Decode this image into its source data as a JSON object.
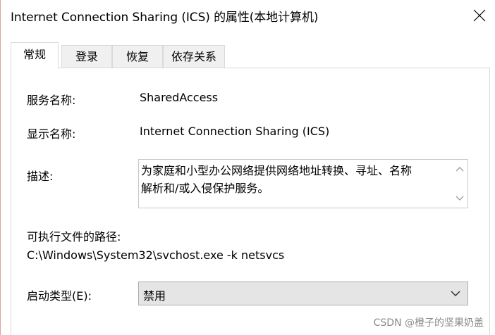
{
  "window": {
    "title": "Internet Connection Sharing (ICS) 的属性(本地计算机)"
  },
  "tabs": [
    {
      "label": "常规",
      "active": true
    },
    {
      "label": "登录",
      "active": false
    },
    {
      "label": "恢复",
      "active": false
    },
    {
      "label": "依存关系",
      "active": false
    }
  ],
  "general": {
    "service_name_label": "服务名称:",
    "service_name_value": "SharedAccess",
    "display_name_label": "显示名称:",
    "display_name_value": "Internet Connection Sharing (ICS)",
    "description_label": "描述:",
    "description_line1": "为家庭和小型办公网络提供网络地址转换、寻址、名称",
    "description_line2": "解析和/或入侵保护服务。",
    "exe_path_label": "可执行文件的路径:",
    "exe_path_value": "C:\\Windows\\System32\\svchost.exe -k netsvcs",
    "startup_type_label": "启动类型(E):",
    "startup_type_value": "禁用"
  },
  "watermark": "CSDN @橙子的坚果奶盖",
  "icons": {
    "close": "close-icon",
    "scroll_up": "chevron-up-icon",
    "scroll_down": "chevron-down-icon",
    "dropdown": "chevron-down-icon"
  },
  "colors": {
    "tab_border": "#d9d9d9",
    "inactive_tab_bg": "#f0f0f0",
    "select_bg": "#e5e5e5",
    "watermark": "#8a8a8a"
  }
}
